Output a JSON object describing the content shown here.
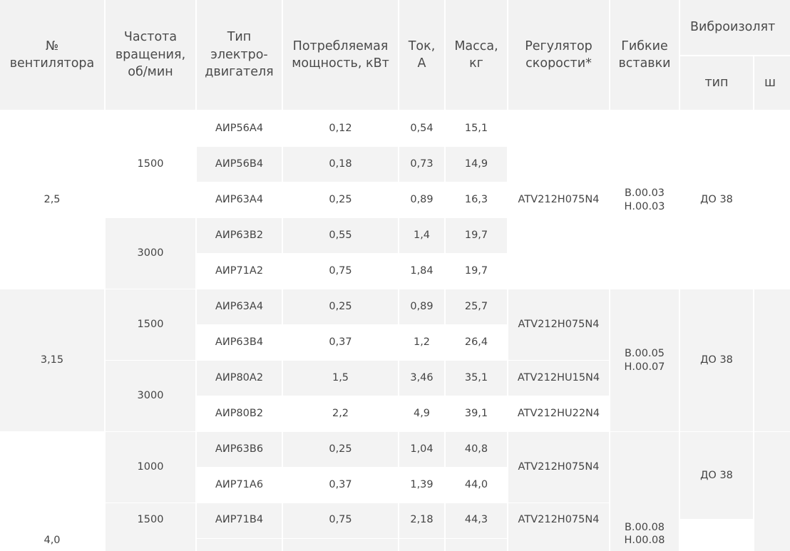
{
  "colors": {
    "header_bg": "#f2f2f2",
    "zebra_bg": "#f3f3f3",
    "white_bg": "#ffffff",
    "text": "#444444"
  },
  "header": {
    "fan_no": "№\nвентилятора",
    "rpm": "Частота\nвращения,\nоб/мин",
    "motor": "Тип\nэлектро-\nдвигателя",
    "power": "Потребляемая\nмощность, кВт",
    "current": "Ток,\nА",
    "mass": "Масса,\nкг",
    "regulator": "Регулятор\nскорости*",
    "inserts": "Гибкие\nвставки",
    "vibro": "Виброизолят",
    "vibro_type": "тип",
    "vibro_cut": "ш"
  },
  "fans": [
    "2,5",
    "3,15",
    "4,0"
  ],
  "rpm": [
    "1500",
    "3000",
    "1500",
    "3000",
    "1000",
    "1500"
  ],
  "regulators": [
    "ATV212H075N4",
    "ATV212H075N4",
    "ATV212HU15N4",
    "ATV212HU22N4",
    "ATV212H075N4",
    "ATV212H075N4"
  ],
  "inserts": [
    "В.00.03\nН.00.03",
    "В.00.05\nН.00.07",
    "В.00.08\nН.00.08"
  ],
  "vibro": [
    "ДО 38",
    "ДО 38",
    "ДО 38"
  ],
  "rows": [
    {
      "motor": "АИР56А4",
      "power": "0,12",
      "current": "0,54",
      "mass": "15,1"
    },
    {
      "motor": "АИР56В4",
      "power": "0,18",
      "current": "0,73",
      "mass": "14,9"
    },
    {
      "motor": "АИР63А4",
      "power": "0,25",
      "current": "0,89",
      "mass": "16,3"
    },
    {
      "motor": "АИР63В2",
      "power": "0,55",
      "current": "1,4",
      "mass": "19,7"
    },
    {
      "motor": "АИР71А2",
      "power": "0,75",
      "current": "1,84",
      "mass": "19,7"
    },
    {
      "motor": "АИР63А4",
      "power": "0,25",
      "current": "0,89",
      "mass": "25,7"
    },
    {
      "motor": "АИР63В4",
      "power": "0,37",
      "current": "1,2",
      "mass": "26,4"
    },
    {
      "motor": "АИР80А2",
      "power": "1,5",
      "current": "3,46",
      "mass": "35,1"
    },
    {
      "motor": "АИР80В2",
      "power": "2,2",
      "current": "4,9",
      "mass": "39,1"
    },
    {
      "motor": "АИР63В6",
      "power": "0,25",
      "current": "1,04",
      "mass": "40,8"
    },
    {
      "motor": "АИР71А6",
      "power": "0,37",
      "current": "1,39",
      "mass": "44,0"
    },
    {
      "motor": "АИР71В4",
      "power": "0,75",
      "current": "2,18",
      "mass": "44,3"
    }
  ]
}
